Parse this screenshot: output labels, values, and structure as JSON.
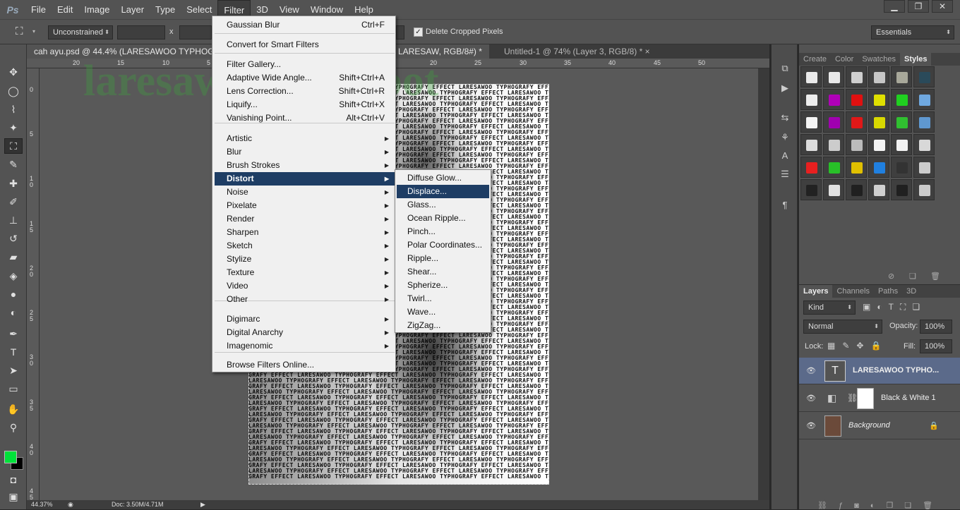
{
  "menubar": {
    "logo": "Ps",
    "items": [
      "File",
      "Edit",
      "Image",
      "Layer",
      "Type",
      "Select",
      "Filter",
      "3D",
      "View",
      "Window",
      "Help"
    ],
    "window_controls": [
      "▁",
      "❐",
      "✕"
    ]
  },
  "options": {
    "ratio": "Unconstrained",
    "x_sep": "x",
    "delete_cropped": "Delete Cropped Pixels",
    "workspace": "Essentials"
  },
  "tabs": [
    {
      "label": "cah ayu.psd @ 44.4% (LARESAWOO TYPHOGR"
    },
    {
      "label": "LARESAW, RGB/8#) *"
    },
    {
      "label": "Untitled-1 @ 74% (Layer 3, RGB/8) *"
    }
  ],
  "tab_close": "×",
  "ruler_h": [
    "20",
    "15",
    "10",
    "5",
    "0",
    "5",
    "10",
    "15",
    "20",
    "25",
    "30",
    "35",
    "40",
    "45",
    "50"
  ],
  "ruler_v": [
    "0",
    "5",
    "1 0",
    "1 5",
    "2 0",
    "2 5",
    "3 0",
    "3 5",
    "4 0",
    "4 5"
  ],
  "status": {
    "zoom": "44.37%",
    "doc": "Doc: 3.50M/4.71M"
  },
  "watermark": "laresawoo.blogspot",
  "typo_text": "LARESAWOO TYPHOGRAFY EFFECT LARESAWOO TYPHOGRAFY EFFECT LARESAWOO TYPHOGRAFY EFFECT",
  "typo_text_b": "GRAFY EFFECT LARESAWOO TYPHOGRAFY EFFECT LARESAWOO TYPHOGRAFY EFFECT LARESAWOO TYPHO",
  "filter_menu": {
    "items": [
      {
        "label": "Gaussian Blur",
        "shortcut": "Ctrl+F"
      },
      {
        "label": "Convert for Smart Filters",
        "shortcut": ""
      },
      {
        "label": "Filter Gallery...",
        "shortcut": ""
      },
      {
        "label": "Adaptive Wide Angle...",
        "shortcut": "Shift+Ctrl+A"
      },
      {
        "label": "Lens Correction...",
        "shortcut": "Shift+Ctrl+R"
      },
      {
        "label": "Liquify...",
        "shortcut": "Shift+Ctrl+X"
      },
      {
        "label": "Vanishing Point...",
        "shortcut": "Alt+Ctrl+V"
      },
      {
        "label": "Artistic",
        "shortcut": ""
      },
      {
        "label": "Blur",
        "shortcut": ""
      },
      {
        "label": "Brush Strokes",
        "shortcut": ""
      },
      {
        "label": "Distort",
        "shortcut": ""
      },
      {
        "label": "Noise",
        "shortcut": ""
      },
      {
        "label": "Pixelate",
        "shortcut": ""
      },
      {
        "label": "Render",
        "shortcut": ""
      },
      {
        "label": "Sharpen",
        "shortcut": ""
      },
      {
        "label": "Sketch",
        "shortcut": ""
      },
      {
        "label": "Stylize",
        "shortcut": ""
      },
      {
        "label": "Texture",
        "shortcut": ""
      },
      {
        "label": "Video",
        "shortcut": ""
      },
      {
        "label": "Other",
        "shortcut": ""
      },
      {
        "label": "Digimarc",
        "shortcut": ""
      },
      {
        "label": "Digital Anarchy",
        "shortcut": ""
      },
      {
        "label": "Imagenomic",
        "shortcut": ""
      },
      {
        "label": "Browse Filters Online...",
        "shortcut": ""
      }
    ],
    "submenu_arrow": "▶"
  },
  "distort_submenu": [
    "Diffuse Glow...",
    "Displace...",
    "Glass...",
    "Ocean Ripple...",
    "Pinch...",
    "Polar Coordinates...",
    "Ripple...",
    "Shear...",
    "Spherize...",
    "Twirl...",
    "Wave...",
    "ZigZag..."
  ],
  "styles_panel": {
    "tabs": [
      "Create",
      "Color",
      "Swatches",
      "Styles"
    ]
  },
  "layers_panel": {
    "tabs": [
      "Layers",
      "Channels",
      "Paths",
      "3D"
    ],
    "kind": "Kind",
    "blend": "Normal",
    "opacity_label": "Opacity:",
    "opacity": "100%",
    "lock_label": "Lock:",
    "fill_label": "Fill:",
    "fill": "100%",
    "layers": [
      "LARESAWOO TYPHO...",
      "Black & White 1",
      "Background"
    ],
    "text_thumb": "T"
  },
  "colors": {
    "foreground": "#00e23a",
    "background": "#000000",
    "menu_highlight": "#1e3d64"
  }
}
